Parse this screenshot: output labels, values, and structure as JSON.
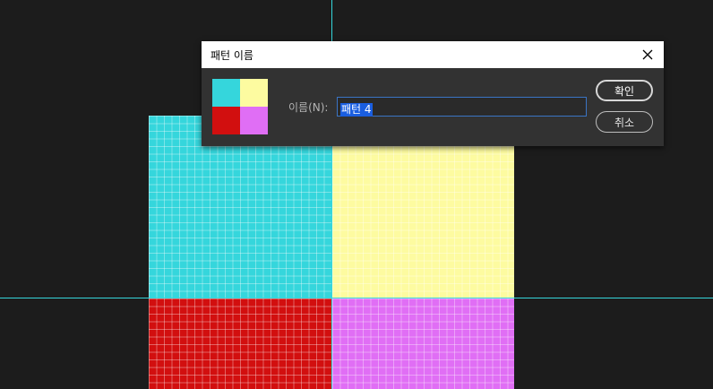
{
  "dialog": {
    "title": "패턴 이름",
    "name_label": "이름(N):",
    "name_value": "패턴 4",
    "ok_label": "확인",
    "cancel_label": "취소",
    "close_icon": "close-icon"
  },
  "colors": {
    "background": "#1c1c1c",
    "cyan": "#35d6dc",
    "yellow": "#fdfba0",
    "red": "#d20f0f",
    "violet": "#e06ef5",
    "guide": "#35d6dc",
    "selection": "#1a5ee0"
  }
}
